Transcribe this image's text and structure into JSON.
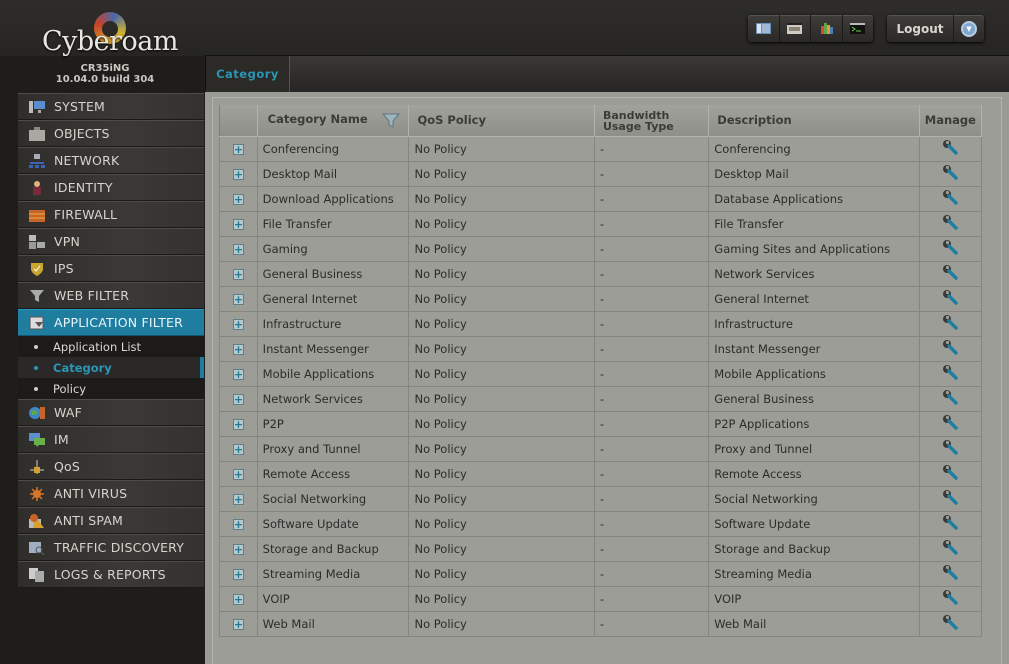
{
  "brand": {
    "logo_text": "Cyberoam",
    "model": "CR35iNG",
    "version": "10.04.0 build 304"
  },
  "toolbar": {
    "icons": [
      "dashboard-icon",
      "console-icon",
      "reports-icon",
      "cli-icon"
    ],
    "logout_label": "Logout",
    "menu_icon": "chevron-down-circle-icon"
  },
  "sidebar": {
    "items": [
      {
        "label": "SYSTEM",
        "icon": "monitor-icon"
      },
      {
        "label": "OBJECTS",
        "icon": "briefcase-icon"
      },
      {
        "label": "NETWORK",
        "icon": "network-icon"
      },
      {
        "label": "IDENTITY",
        "icon": "user-icon"
      },
      {
        "label": "FIREWALL",
        "icon": "firewall-icon"
      },
      {
        "label": "VPN",
        "icon": "vpn-icon"
      },
      {
        "label": "IPS",
        "icon": "shield-icon"
      },
      {
        "label": "WEB FILTER",
        "icon": "funnel-icon"
      },
      {
        "label": "APPLICATION FILTER",
        "icon": "app-filter-icon",
        "active": true,
        "children": [
          {
            "label": "Application List"
          },
          {
            "label": "Category",
            "active": true
          },
          {
            "label": "Policy"
          }
        ]
      },
      {
        "label": "WAF",
        "icon": "globe-wall-icon"
      },
      {
        "label": "IM",
        "icon": "chat-icon"
      },
      {
        "label": "QoS",
        "icon": "qos-icon"
      },
      {
        "label": "ANTI VIRUS",
        "icon": "virus-icon"
      },
      {
        "label": "ANTI SPAM",
        "icon": "spam-icon"
      },
      {
        "label": "TRAFFIC DISCOVERY",
        "icon": "traffic-search-icon"
      },
      {
        "label": "LOGS & REPORTS",
        "icon": "documents-icon"
      }
    ]
  },
  "tabs": [
    {
      "label": "Category",
      "active": true
    }
  ],
  "table": {
    "columns": {
      "name": "Category Name",
      "qos": "QoS Policy",
      "bw_line1": "Bandwidth",
      "bw_line2": "Usage Type",
      "description": "Description",
      "manage": "Manage"
    },
    "rows": [
      {
        "name": "Conferencing",
        "qos": "No Policy",
        "bw": "-",
        "description": "Conferencing"
      },
      {
        "name": "Desktop Mail",
        "qos": "No Policy",
        "bw": "-",
        "description": "Desktop Mail"
      },
      {
        "name": "Download Applications",
        "qos": "No Policy",
        "bw": "-",
        "description": "Database Applications"
      },
      {
        "name": "File Transfer",
        "qos": "No Policy",
        "bw": "-",
        "description": "File Transfer"
      },
      {
        "name": "Gaming",
        "qos": "No Policy",
        "bw": "-",
        "description": "Gaming Sites and Applications"
      },
      {
        "name": "General Business",
        "qos": "No Policy",
        "bw": "-",
        "description": "Network Services"
      },
      {
        "name": "General Internet",
        "qos": "No Policy",
        "bw": "-",
        "description": "General Internet"
      },
      {
        "name": "Infrastructure",
        "qos": "No Policy",
        "bw": "-",
        "description": "Infrastructure"
      },
      {
        "name": "Instant Messenger",
        "qos": "No Policy",
        "bw": "-",
        "description": "Instant Messenger"
      },
      {
        "name": "Mobile Applications",
        "qos": "No Policy",
        "bw": "-",
        "description": "Mobile Applications"
      },
      {
        "name": "Network Services",
        "qos": "No Policy",
        "bw": "-",
        "description": "General Business"
      },
      {
        "name": "P2P",
        "qos": "No Policy",
        "bw": "-",
        "description": "P2P Applications"
      },
      {
        "name": "Proxy and Tunnel",
        "qos": "No Policy",
        "bw": "-",
        "description": "Proxy and Tunnel"
      },
      {
        "name": "Remote Access",
        "qos": "No Policy",
        "bw": "-",
        "description": "Remote Access"
      },
      {
        "name": "Social Networking",
        "qos": "No Policy",
        "bw": "-",
        "description": "Social Networking"
      },
      {
        "name": "Software Update",
        "qos": "No Policy",
        "bw": "-",
        "description": "Software Update"
      },
      {
        "name": "Storage and Backup",
        "qos": "No Policy",
        "bw": "-",
        "description": "Storage and Backup"
      },
      {
        "name": "Streaming Media",
        "qos": "No Policy",
        "bw": "-",
        "description": "Streaming Media"
      },
      {
        "name": "VOIP",
        "qos": "No Policy",
        "bw": "-",
        "description": "VOIP"
      },
      {
        "name": "Web Mail",
        "qos": "No Policy",
        "bw": "-",
        "description": "Web Mail"
      }
    ]
  },
  "colors": {
    "accent": "#1f7ea0",
    "accent_text": "#2a95b5"
  }
}
